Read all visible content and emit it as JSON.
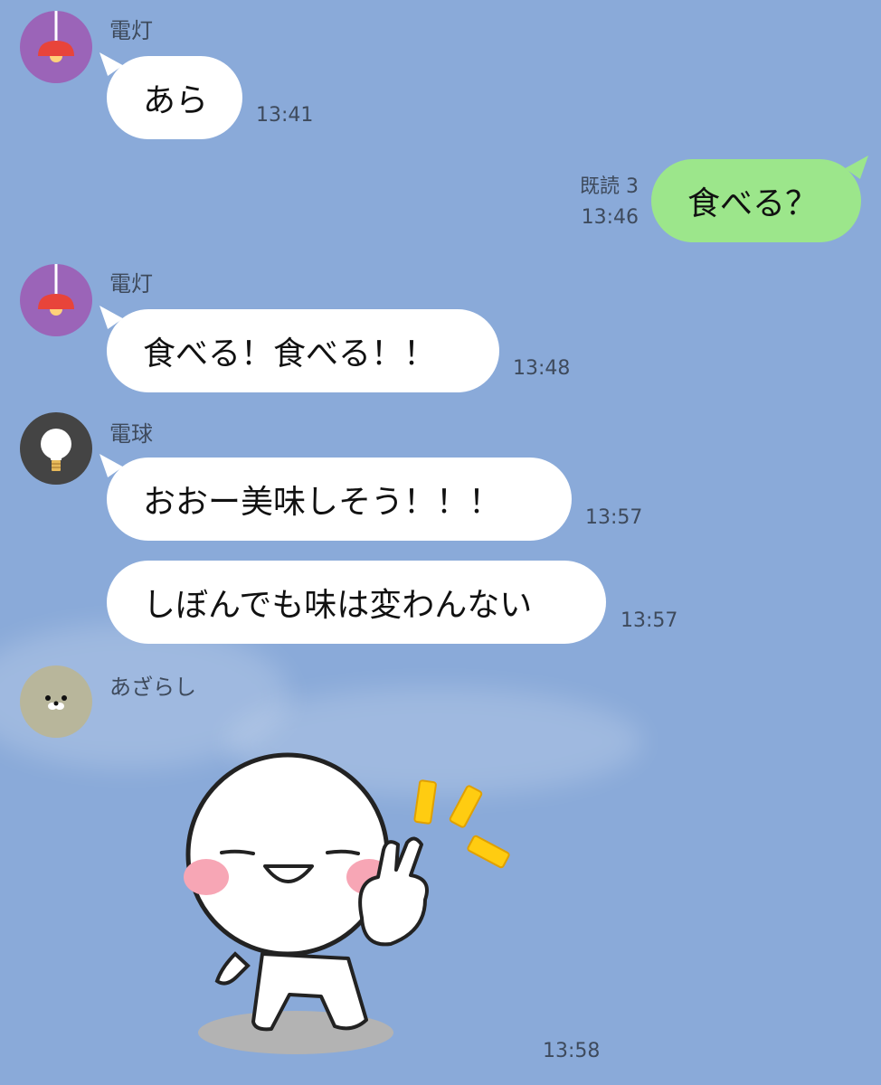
{
  "messages": [
    {
      "sender": "電灯",
      "text": "あら",
      "time": "13:41"
    },
    {
      "text": "食べる？",
      "read": "既読 3",
      "time": "13:46"
    },
    {
      "sender": "電灯",
      "text": "食べる！食べる！！",
      "time": "13:48"
    },
    {
      "sender": "電球",
      "text": "おおー美味しそう！！！",
      "time": "13:57"
    },
    {
      "text": "しぼんでも味は変わんない",
      "time": "13:57"
    },
    {
      "sender": "あざらし",
      "sticker": "smiling-peace-sign-sticker",
      "time": "13:58"
    }
  ],
  "colors": {
    "background": "#8aaad9",
    "bubble_incoming": "#ffffff",
    "bubble_outgoing": "#9ce68b",
    "avatar_lamp": "#9b64b8",
    "avatar_bulb": "#444444",
    "avatar_seal": "#b8b69b"
  },
  "icons": [
    "ceiling-lamp-icon",
    "light-bulb-icon",
    "seal-face-icon"
  ]
}
